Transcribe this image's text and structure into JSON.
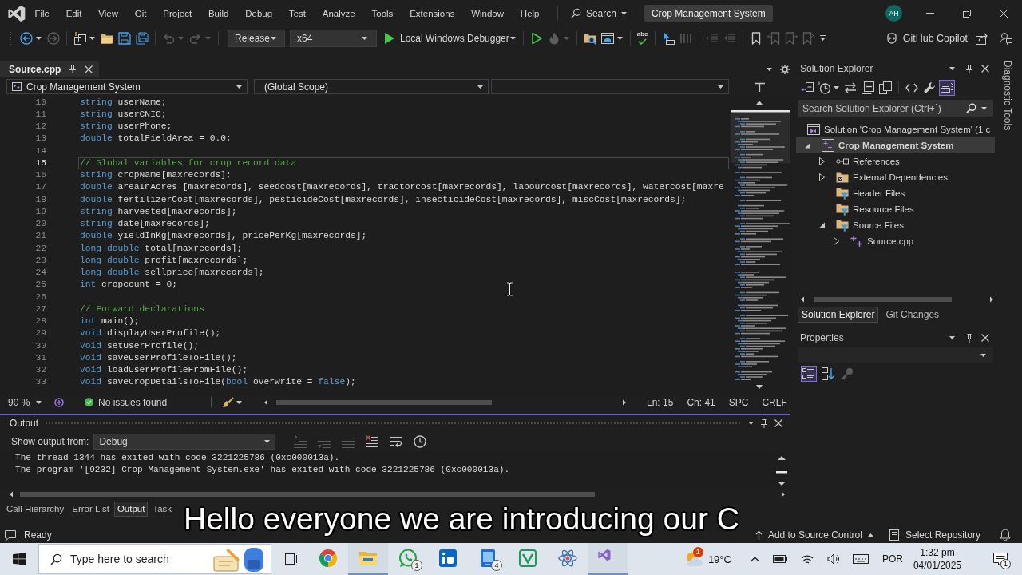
{
  "title_bar": {
    "menu": [
      "File",
      "Edit",
      "View",
      "Git",
      "Project",
      "Build",
      "Debug",
      "Test",
      "Analyze",
      "Tools",
      "Extensions",
      "Window",
      "Help"
    ],
    "search": "Search",
    "solution_name": "Crop Management System",
    "account_initials": "AH"
  },
  "toolbar": {
    "groups_before": [
      [
        {
          "kind": "back",
          "disabled": false,
          "menu": true
        },
        {
          "kind": "forward",
          "disabled": true
        }
      ],
      [
        {
          "kind": "new",
          "disabled": false,
          "menu": true
        },
        {
          "kind": "folder",
          "disabled": false
        },
        {
          "kind": "save",
          "disabled": false
        },
        {
          "kind": "saveall",
          "disabled": false
        }
      ],
      [
        {
          "kind": "undo",
          "disabled": true,
          "menu": true
        },
        {
          "kind": "redo",
          "disabled": true,
          "menu": true
        }
      ]
    ],
    "configuration": "Release",
    "platform": "x64",
    "debugger": "Local Windows Debugger",
    "groups_after": [
      [
        {
          "kind": "play",
          "disabled": false
        },
        {
          "kind": "flame",
          "disabled": true,
          "menu": true
        }
      ],
      [
        {
          "kind": "findfolder",
          "disabled": false
        },
        {
          "kind": "window",
          "disabled": false,
          "menu": true
        }
      ],
      [
        {
          "kind": "spell",
          "label": "abc",
          "disabled": false
        }
      ],
      [
        {
          "kind": "pointer",
          "disabled": false
        },
        {
          "kind": "columns",
          "disabled": true
        }
      ],
      [
        {
          "kind": "indent",
          "disabled": true
        },
        {
          "kind": "outdent",
          "disabled": true
        }
      ],
      [
        {
          "kind": "bookmark",
          "disabled": false
        },
        {
          "kind": "bookmarkleft",
          "disabled": true
        },
        {
          "kind": "bookmarkright",
          "disabled": true
        },
        {
          "kind": "bookmarkclear",
          "disabled": true
        }
      ]
    ],
    "copilot": "GitHub Copilot"
  },
  "editor": {
    "tab": {
      "label": "Source.cpp",
      "selected": true
    },
    "project_scope": "Crop Management System",
    "member_scope": "(Global Scope)",
    "lines": [
      {
        "number": "10",
        "current": false,
        "tokens": [
          {
            "kind": "keyword",
            "text": "string"
          },
          {
            "kind": "plain",
            "text": " userName;"
          }
        ]
      },
      {
        "number": "11",
        "current": false,
        "tokens": [
          {
            "kind": "keyword",
            "text": "string"
          },
          {
            "kind": "plain",
            "text": " userCNIC;"
          }
        ]
      },
      {
        "number": "12",
        "current": false,
        "tokens": [
          {
            "kind": "keyword",
            "text": "string"
          },
          {
            "kind": "plain",
            "text": " userPhone;"
          }
        ]
      },
      {
        "number": "13",
        "current": false,
        "tokens": [
          {
            "kind": "keyword",
            "text": "double"
          },
          {
            "kind": "plain",
            "text": " totalFieldArea = 0.0;"
          }
        ]
      },
      {
        "number": "14",
        "current": false
      },
      {
        "number": "15",
        "current": true,
        "tokens": [
          {
            "kind": "comment",
            "text": "// Global variables for crop record data"
          }
        ]
      },
      {
        "number": "16",
        "current": false,
        "tokens": [
          {
            "kind": "keyword",
            "text": "string"
          },
          {
            "kind": "plain",
            "text": " cropName[maxrecords];"
          }
        ]
      },
      {
        "number": "17",
        "current": false,
        "tokens": [
          {
            "kind": "keyword",
            "text": "double"
          },
          {
            "kind": "plain",
            "text": " areaInAcres [maxrecords], seedcost[maxrecords], tractorcost[maxrecords], labourcost[maxrecords], watercost[maxre"
          }
        ]
      },
      {
        "number": "18",
        "current": false,
        "tokens": [
          {
            "kind": "keyword",
            "text": "double"
          },
          {
            "kind": "plain",
            "text": " fertilizerCost[maxrecords], pesticideCost[maxrecords], insecticideCost[maxrecords], miscCost[maxrecords];"
          }
        ]
      },
      {
        "number": "19",
        "current": false,
        "tokens": [
          {
            "kind": "keyword",
            "text": "string"
          },
          {
            "kind": "plain",
            "text": " harvested[maxrecords];"
          }
        ]
      },
      {
        "number": "20",
        "current": false,
        "tokens": [
          {
            "kind": "keyword",
            "text": "string"
          },
          {
            "kind": "plain",
            "text": " date[maxrecords];"
          }
        ]
      },
      {
        "number": "21",
        "current": false,
        "tokens": [
          {
            "kind": "keyword",
            "text": "double"
          },
          {
            "kind": "plain",
            "text": " yieldInKg[maxrecords], pricePerKg[maxrecords];"
          }
        ]
      },
      {
        "number": "22",
        "current": false,
        "tokens": [
          {
            "kind": "keyword",
            "text": "long double"
          },
          {
            "kind": "plain",
            "text": " total[maxrecords];"
          }
        ]
      },
      {
        "number": "23",
        "current": false,
        "tokens": [
          {
            "kind": "keyword",
            "text": "long double"
          },
          {
            "kind": "plain",
            "text": " profit[maxrecords];"
          }
        ]
      },
      {
        "number": "24",
        "current": false,
        "tokens": [
          {
            "kind": "keyword",
            "text": "long double"
          },
          {
            "kind": "plain",
            "text": " sellprice[maxrecords];"
          }
        ]
      },
      {
        "number": "25",
        "current": false,
        "tokens": [
          {
            "kind": "keyword",
            "text": "int"
          },
          {
            "kind": "plain",
            "text": " cropcount = 0;"
          }
        ]
      },
      {
        "number": "26",
        "current": false
      },
      {
        "number": "27",
        "current": false,
        "tokens": [
          {
            "kind": "comment",
            "text": "// Forward declarations"
          }
        ]
      },
      {
        "number": "28",
        "current": false,
        "tokens": [
          {
            "kind": "keyword",
            "text": "int"
          },
          {
            "kind": "plain",
            "text": " main();"
          }
        ]
      },
      {
        "number": "29",
        "current": false,
        "tokens": [
          {
            "kind": "keyword",
            "text": "void"
          },
          {
            "kind": "plain",
            "text": " displayUserProfile();"
          }
        ]
      },
      {
        "number": "30",
        "current": false,
        "tokens": [
          {
            "kind": "keyword",
            "text": "void"
          },
          {
            "kind": "plain",
            "text": " setUserProfile();"
          }
        ]
      },
      {
        "number": "31",
        "current": false,
        "tokens": [
          {
            "kind": "keyword",
            "text": "void"
          },
          {
            "kind": "plain",
            "text": " saveUserProfileToFile();"
          }
        ]
      },
      {
        "number": "32",
        "current": false,
        "tokens": [
          {
            "kind": "keyword",
            "text": "void"
          },
          {
            "kind": "plain",
            "text": " loadUserProfileFromFile();"
          }
        ]
      },
      {
        "number": "33",
        "current": false,
        "tokens": [
          {
            "kind": "keyword",
            "text": "void"
          },
          {
            "kind": "plain",
            "text": " saveCropDetailsToFile("
          },
          {
            "kind": "keyword",
            "text": "bool"
          },
          {
            "kind": "plain",
            "text": " overwrite = "
          },
          {
            "kind": "keyword",
            "text": "false"
          },
          {
            "kind": "plain",
            "text": ");"
          }
        ]
      }
    ],
    "zoom": "90 %",
    "issues": "No issues found",
    "line": "Ln: 15",
    "column": "Ch: 41",
    "whitespace": "SPC",
    "line_ending": "CRLF"
  },
  "output": {
    "title": "Output",
    "source_label": "Show output from:",
    "source": "Debug",
    "toolbar": [
      {
        "kind": "up",
        "disabled": true
      },
      {
        "kind": "down",
        "disabled": true
      },
      {
        "kind": "lines",
        "disabled": true
      },
      {
        "kind": "clear",
        "disabled": false
      },
      {
        "kind": "wrap",
        "disabled": false
      },
      {
        "kind": "clock",
        "disabled": false
      }
    ],
    "lines": [
      "The thread 1344 has exited with code 3221225786 (0xc000013a).",
      "The program '[9232] Crop Management System.exe' has exited with code 3221225786 (0xc000013a)."
    ],
    "tabs": [
      {
        "label": "Call Hierarchy",
        "selected": false
      },
      {
        "label": "Error List",
        "selected": false
      },
      {
        "label": "Output",
        "selected": true
      },
      {
        "label": "Task",
        "selected": false
      }
    ]
  },
  "solution_explorer": {
    "title": "Solution Explorer",
    "toolbar": [
      {
        "kind": "switch",
        "on": false
      },
      {
        "kind": "history",
        "on": false,
        "menu": true
      },
      {
        "kind": "sync",
        "on": false
      },
      {
        "kind": "collapse",
        "on": false
      },
      {
        "kind": "showall",
        "on": false
      },
      {
        "kind": "code",
        "on": false
      },
      {
        "kind": "wrench",
        "on": false
      },
      {
        "kind": "preview",
        "on": true
      }
    ],
    "search_placeholder": "Search Solution Explorer (Ctrl+´)",
    "tree": [
      {
        "kind": "solution",
        "label": "Solution 'Crop Management System' (1 c",
        "selected": false,
        "children": [
          {
            "kind": "project",
            "label": "Crop Management System",
            "selected": true,
            "expanded": true,
            "children": [
              {
                "kind": "references",
                "label": "References",
                "selected": false,
                "expanded": false
              },
              {
                "kind": "dependencies",
                "label": "External Dependencies",
                "selected": false,
                "expanded": false
              },
              {
                "kind": "filter",
                "label": "Header Files",
                "selected": false
              },
              {
                "kind": "filter",
                "label": "Resource Files",
                "selected": false
              },
              {
                "kind": "filter",
                "label": "Source Files",
                "selected": false,
                "expanded": true,
                "children": [
                  {
                    "kind": "source",
                    "label": "Source.cpp",
                    "selected": false,
                    "expanded": false
                  }
                ]
              }
            ]
          }
        ]
      }
    ],
    "tabs": [
      {
        "label": "Solution Explorer",
        "selected": true
      },
      {
        "label": "Git Changes",
        "selected": false
      }
    ]
  },
  "properties": {
    "title": "Properties",
    "toolbar": [
      {
        "kind": "categorized",
        "on": true,
        "disabled": false
      },
      {
        "kind": "alphabetical",
        "on": false,
        "disabled": false
      },
      {
        "kind": "pages",
        "on": false,
        "disabled": true
      }
    ]
  },
  "side_tab": "Diagnostic Tools",
  "status_bar": {
    "message": "Ready",
    "source_control": "Add to Source Control",
    "repository": "Select Repository"
  },
  "taskbar": {
    "search_placeholder": "Type here to search",
    "apps": [
      {
        "kind": "browser",
        "active": false
      },
      {
        "kind": "files",
        "active": true
      },
      {
        "kind": "chat",
        "active": false,
        "badge": "1"
      },
      {
        "kind": "square",
        "active": false
      },
      {
        "kind": "tablet",
        "active": false,
        "badge": "4"
      },
      {
        "kind": "chevron",
        "active": false
      },
      {
        "kind": "atom",
        "active": false
      },
      {
        "kind": "studio",
        "active": true
      }
    ],
    "weather_badge": "1",
    "temperature": "19°C",
    "language": "POR",
    "time": "1:32 pm",
    "date": "04/01/2025",
    "notification_badge": "1"
  },
  "caption": "Hello everyone we are introducing our C"
}
